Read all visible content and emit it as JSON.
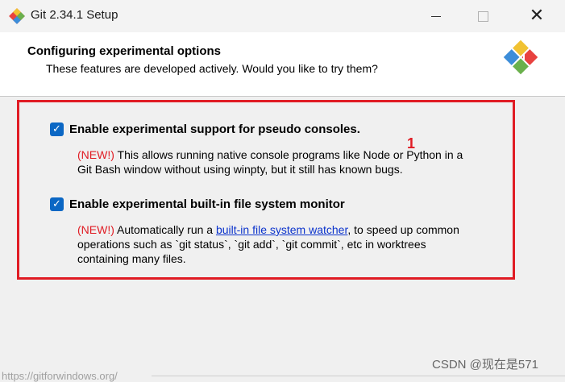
{
  "window": {
    "title": "Git 2.34.1 Setup",
    "close_glyph": "✕"
  },
  "header": {
    "title": "Configuring experimental options",
    "subtitle": "These features are developed actively. Would you like to try them?",
    "logo_icon": "git-logo-icon"
  },
  "options": [
    {
      "label": "Enable experimental support for pseudo consoles.",
      "checked": true,
      "new_tag": "(NEW!)",
      "desc_line1": " This allows running native console programs like Node or Python in a",
      "desc_line2": "Git Bash window without using winpty, but it still has known bugs."
    },
    {
      "label": "Enable experimental built-in file system monitor",
      "checked": true,
      "new_tag": "(NEW!)",
      "desc_pre": " Automatically run a ",
      "link_text": "built-in file system watcher",
      "desc_post": ", to speed up common",
      "desc_line2": "operations such as `git status`, `git add`, `git commit`, etc in worktrees",
      "desc_line3": "containing many files."
    }
  ],
  "annotation": {
    "number": "1",
    "color": "#e01c24"
  },
  "footer": {
    "url": "https://gitforwindows.org/",
    "watermark": "CSDN @现在是571"
  },
  "colors": {
    "checkbox": "#0b67c4",
    "link": "#0b33cc",
    "highlight": "#e01c24"
  },
  "icons": [
    "git-app-icon",
    "minimize-icon",
    "maximize-icon",
    "close-icon",
    "check-icon"
  ]
}
